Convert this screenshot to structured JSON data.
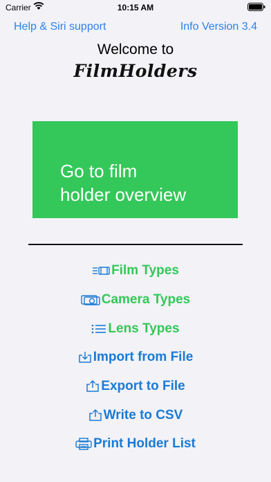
{
  "status": {
    "carrier": "Carrier",
    "time": "10:15 AM"
  },
  "nav": {
    "help_label": "Help & Siri support",
    "info_label": "Info Version 3.4"
  },
  "header": {
    "welcome": "Welcome to",
    "brand": "FilmHolders"
  },
  "primary_button": {
    "label_line1": "Go to film",
    "label_line2": "holder overview"
  },
  "menu": {
    "film_types": "Film Types",
    "camera_types": "Camera Types",
    "lens_types": "Lens Types",
    "import": "Import from File",
    "export": "Export to File",
    "csv": "Write to CSV",
    "print": "Print Holder List"
  },
  "colors": {
    "green": "#34c759",
    "blue": "#1a7ad6",
    "link": "#2f80ed",
    "background": "#f2f2f7"
  }
}
